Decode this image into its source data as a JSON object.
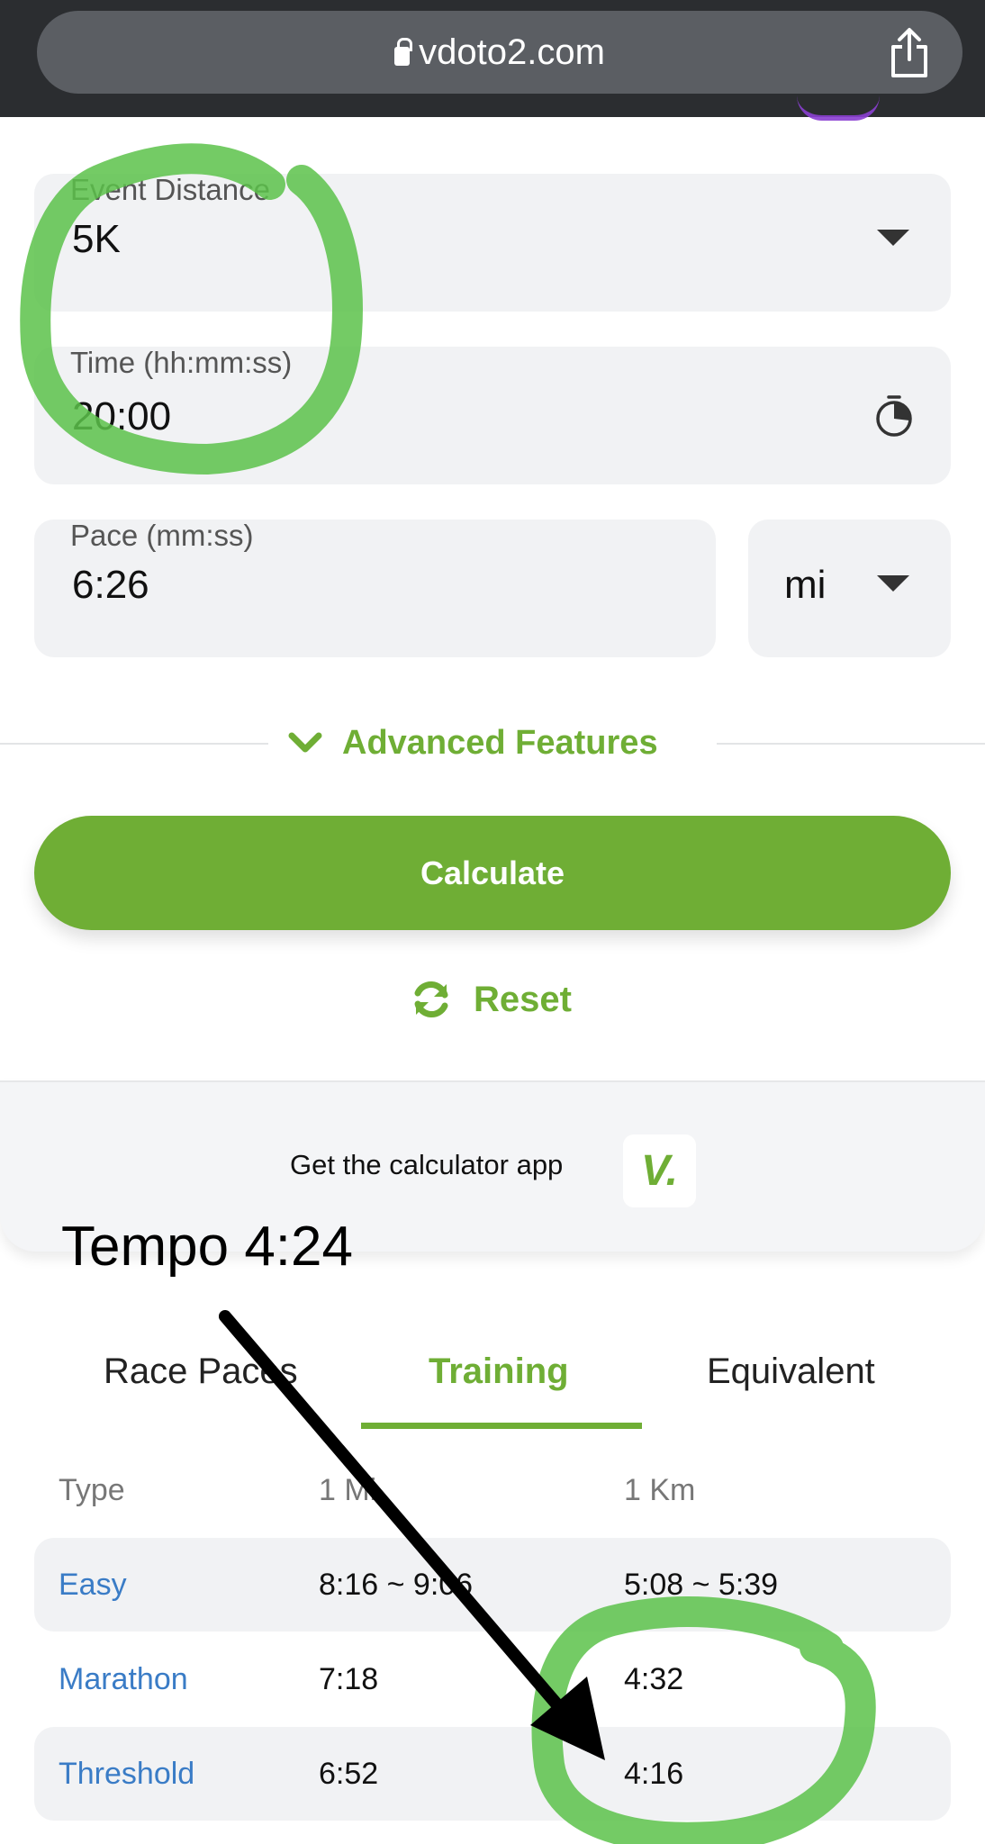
{
  "browser": {
    "url": "vdoto2.com",
    "lock_icon": "lock-icon",
    "share_icon": "share-icon"
  },
  "form": {
    "event_distance": {
      "label": "Event Distance",
      "value": "5K"
    },
    "time": {
      "label": "Time (hh:mm:ss)",
      "value": "20:00",
      "icon": "stopwatch-icon"
    },
    "pace": {
      "label": "Pace (mm:ss)",
      "value": "6:26"
    },
    "pace_unit": {
      "value": "mi"
    }
  },
  "advanced_features": "Advanced Features",
  "calculate_label": "Calculate",
  "reset_label": "Reset",
  "app_promo": {
    "text": "Get the calculator app",
    "logo": "V."
  },
  "tabs": [
    {
      "label": "Race Paces",
      "active": false
    },
    {
      "label": "Training",
      "active": true
    },
    {
      "label": "Equivalent",
      "active": false
    }
  ],
  "table": {
    "headers": [
      "Type",
      "1 Mi",
      "1 Km"
    ],
    "rows": [
      {
        "type": "Easy",
        "mi": "8:16 ~ 9:06",
        "km": "5:08 ~ 5:39"
      },
      {
        "type": "Marathon",
        "mi": "7:18",
        "km": "4:32"
      },
      {
        "type": "Threshold",
        "mi": "6:52",
        "km": "4:16"
      }
    ]
  },
  "annotation": {
    "text": "Tempo 4:24"
  },
  "colors": {
    "accent_green": "#6fae35",
    "link_blue": "#3a7cc6",
    "highlight_green": "#5cc24a"
  }
}
